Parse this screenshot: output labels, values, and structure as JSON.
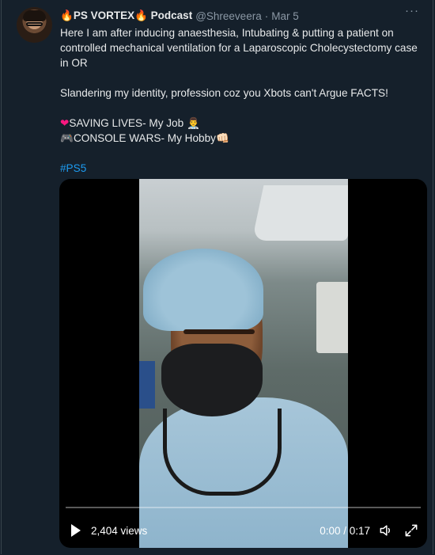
{
  "tweet": {
    "display_name": "PS VORTEX",
    "name_suffix": "Podcast",
    "handle": "@Shreeveera",
    "separator": "·",
    "date": "Mar 5",
    "more": "···",
    "lines": [
      "Here I am after inducing anaesthesia, Intubating & putting a patient on controlled mechanical ventilation for a Laparoscopic Cholecystectomy case in OR",
      "Slandering my identity, profession coz you Xbots can't Argue FACTS!",
      "SAVING LIVES- My Job",
      "CONSOLE WARS- My Hobby"
    ],
    "emoji": {
      "name_prefix": "🔥",
      "name_suffix": "🔥",
      "heart": "❤",
      "doctor": "👨‍⚕️",
      "gamepad": "🎮",
      "fist": "👊🏻"
    },
    "hashtag": "#PS5"
  },
  "media": {
    "views": "2,404 views",
    "time": "0:00 / 0:17",
    "progress": 0
  },
  "colors": {
    "background": "#15202b",
    "text": "#e7e9ea",
    "secondary": "#8b98a5",
    "accent": "#1d9bf0"
  },
  "icons": [
    "flame-icon",
    "more-icon",
    "heart-icon",
    "doctor-icon",
    "gamepad-icon",
    "fist-icon",
    "play-icon",
    "volume-icon",
    "fullscreen-icon"
  ]
}
